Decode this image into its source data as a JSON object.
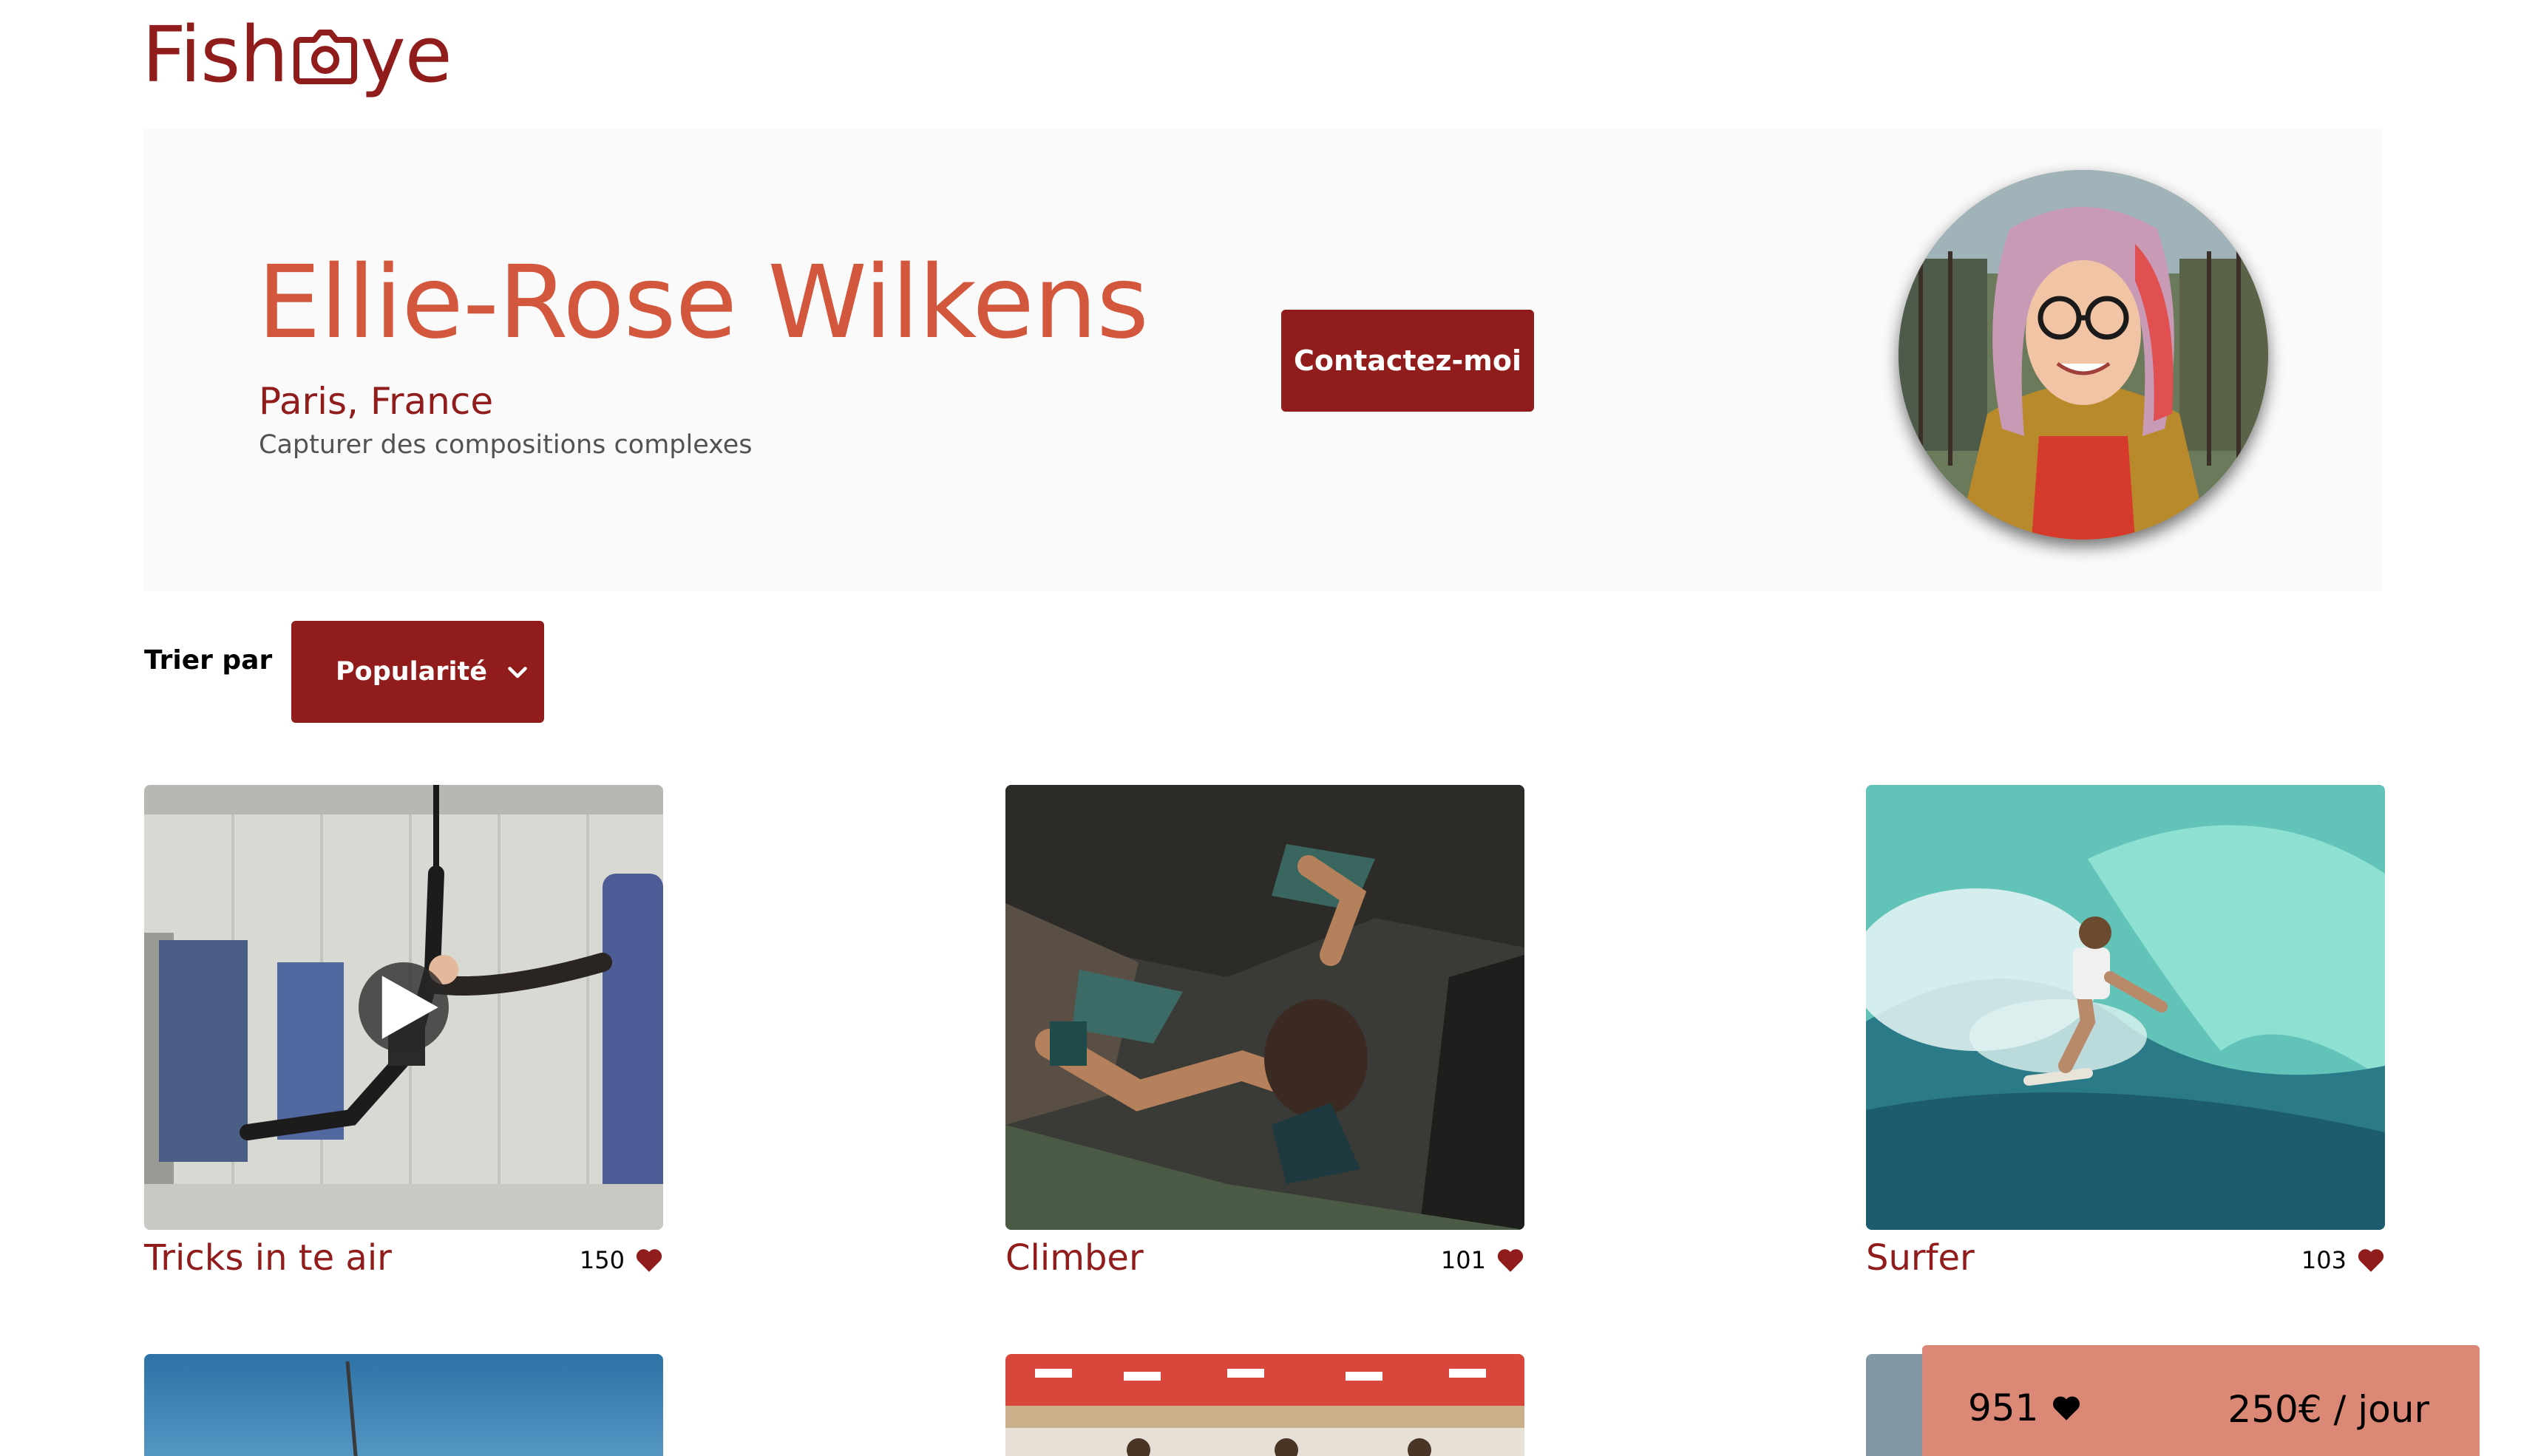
{
  "logo": {
    "text_left": "Fish",
    "text_right": "ye",
    "icon": "camera-icon"
  },
  "photographer": {
    "name": "Ellie-Rose Wilkens",
    "location": "Paris, France",
    "tagline": "Capturer des compositions complexes",
    "contact_label": "Contactez-moi",
    "portrait_icon": "portrait-photo"
  },
  "sort": {
    "label": "Trier par",
    "selected": "Popularité",
    "icon": "chevron-down-icon"
  },
  "gallery": [
    {
      "title": "Tricks in te air",
      "likes": "150",
      "type": "video"
    },
    {
      "title": "Climber",
      "likes": "101",
      "type": "image"
    },
    {
      "title": "Surfer",
      "likes": "103",
      "type": "image"
    }
  ],
  "sticky": {
    "total_likes": "951",
    "price": "250€ / jour"
  },
  "colors": {
    "primary": "#901C1C",
    "secondary": "#D3573C",
    "sticky_bg": "#DB8876",
    "banner_bg": "#FAFAFA"
  }
}
